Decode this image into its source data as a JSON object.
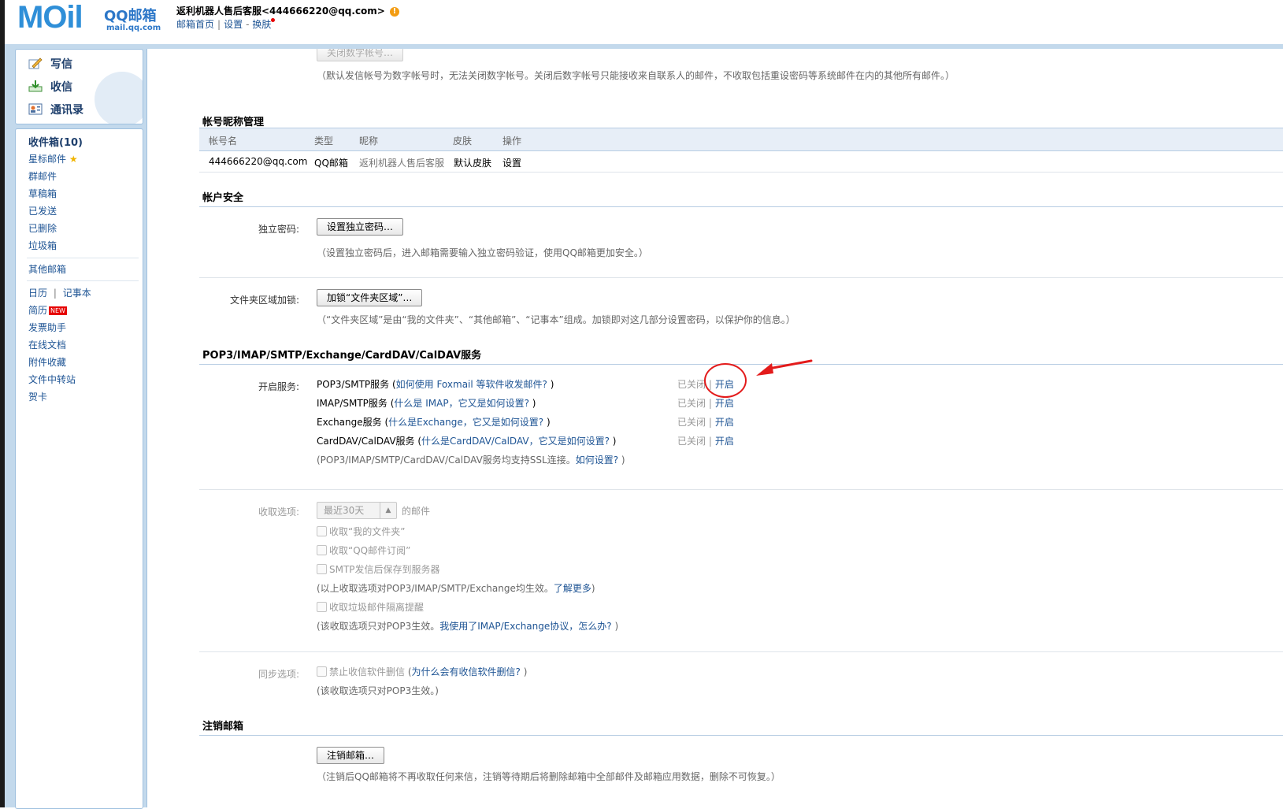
{
  "header": {
    "logo_text": "MOil",
    "brand": "QQ邮箱",
    "domain": "mail.qq.com",
    "account_display": "返利机器人售后客服<444666220@qq.com>",
    "links": {
      "home": "邮箱首页",
      "settings": "设置",
      "skin": "换肤",
      "sep1": "|",
      "sep2": "-"
    }
  },
  "quick_actions": {
    "write": "写信",
    "receive": "收信",
    "contacts": "通讯录"
  },
  "folders": {
    "inbox": "收件箱(10)",
    "starred": "星标邮件",
    "groups": "群邮件",
    "drafts": "草稿箱",
    "sent": "已发送",
    "deleted": "已删除",
    "spam": "垃圾箱",
    "other_mailbox": "其他邮箱",
    "calendar": "日历",
    "cal_sep": "|",
    "notes": "记事本",
    "resume": "简历",
    "new_badge": "NEW",
    "invoice": "发票助手",
    "docs": "在线文档",
    "attachments": "附件收藏",
    "transfer": "文件中转站",
    "cards": "贺卡"
  },
  "top_section": {
    "close_numeric_button": "关闭数字帐号…",
    "note": "（默认发信帐号为数字帐号时，无法关闭数字帐号。关闭后数字帐号只能接收来自联系人的邮件，不收取包括重设密码等系统邮件在内的其他所有邮件。）"
  },
  "nickname_section": {
    "title": "帐号昵称管理",
    "headers": [
      "帐号名",
      "类型",
      "昵称",
      "皮肤",
      "操作"
    ],
    "row": {
      "account": "444666220@qq.com",
      "type": "QQ邮箱",
      "nickname": "返利机器人售后客服",
      "skin": "默认皮肤",
      "action": "设置"
    }
  },
  "security_section": {
    "title": "帐户安全",
    "pwd_label": "独立密码:",
    "pwd_button": "设置独立密码…",
    "pwd_note": "（设置独立密码后，进入邮箱需要输入独立密码验证，使用QQ邮箱更加安全。）",
    "folder_lock_label": "文件夹区域加锁:",
    "folder_lock_button": "加锁“文件夹区域”…",
    "folder_lock_note": "（“文件夹区域”是由“我的文件夹”、“其他邮箱”、“记事本”组成。加锁即对这几部分设置密码，以保护你的信息。）"
  },
  "services_section": {
    "title": "POP3/IMAP/SMTP/Exchange/CardDAV/CalDAV服务",
    "open_label": "开启服务:",
    "services": [
      {
        "name": "POP3/SMTP服务",
        "open_paren": " (",
        "help": "如何使用 Foxmail 等软件收发邮件?",
        "close_paren": " )",
        "status": "已关闭",
        "sep": "|",
        "action": "开启"
      },
      {
        "name": "IMAP/SMTP服务",
        "open_paren": " (",
        "help": "什么是 IMAP，它又是如何设置?",
        "close_paren": " )",
        "status": "已关闭",
        "sep": "|",
        "action": "开启"
      },
      {
        "name": "Exchange服务",
        "open_paren": " (",
        "help": "什么是Exchange，它又是如何设置?",
        "close_paren": " )",
        "status": "已关闭",
        "sep": "|",
        "action": "开启"
      },
      {
        "name": "CardDAV/CalDAV服务",
        "open_paren": " (",
        "help": "什么是CardDAV/CalDAV，它又是如何设置?",
        "close_paren": " )",
        "status": "已关闭",
        "sep": "|",
        "action": "开启"
      }
    ],
    "ssl_note": "(POP3/IMAP/SMTP/CardDAV/CalDAV服务均支持SSL连接。",
    "ssl_link": "如何设置?",
    "ssl_close": " )"
  },
  "receive_options": {
    "label": "收取选项:",
    "select_value": "最近30天",
    "select_suffix": "的邮件",
    "opt_my_folders": "收取“我的文件夹”",
    "opt_subscriptions": "收取“QQ邮件订阅”",
    "opt_smtp_save": "SMTP发信后保存到服务器",
    "note1": "(以上收取选项对POP3/IMAP/SMTP/Exchange均生效。",
    "note1_link": "了解更多",
    "note1_close": ")",
    "opt_spam_alert": "收取垃圾邮件隔离提醒",
    "note2": "(该收取选项只对POP3生效。",
    "note2_link": "我使用了IMAP/Exchange协议，怎么办?",
    "note2_close": " )"
  },
  "sync_options": {
    "label": "同步选项:",
    "opt_no_delete": "禁止收信软件删信",
    "opt_paren_open": " (",
    "opt_link": "为什么会有收信软件删信?",
    "opt_paren_close": " )",
    "note": "(该收取选项只对POP3生效。)"
  },
  "cancel_section": {
    "title": "注销邮箱",
    "button": "注销邮箱…",
    "note": "（注销后QQ邮箱将不再收取任何来信，注销等待期后将删除邮箱中全部邮件及邮箱应用数据，删除不可恢复。）"
  },
  "colors": {
    "accent": "#1e5494",
    "page_bg": "#c3d9ec",
    "annotation": "#e31b1b"
  }
}
